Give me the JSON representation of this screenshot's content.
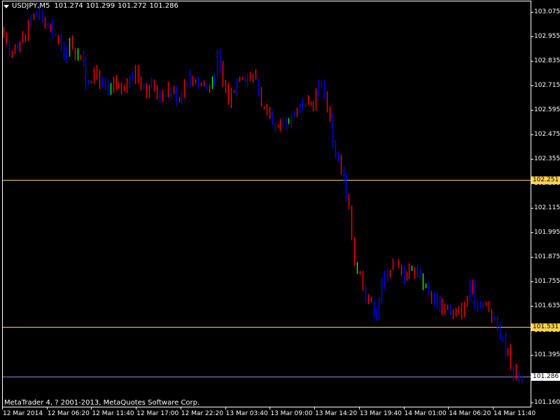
{
  "header": {
    "symbol": "USDJPY,M5",
    "quote_values": [
      "101.274",
      "101.299",
      "101.272",
      "101.286"
    ]
  },
  "footer": {
    "copyright": "MetaTrader 4, ? 2001-2013, MetaQuotes Software Corp."
  },
  "colors": {
    "background": "#000000",
    "frame": "#ffffff",
    "candle_bull": "#00ff00",
    "candle_bear": "#ff0000",
    "candle_mixed": "#0000ff",
    "hline": "#ffcc66",
    "hline_label_bg": "#ffd24d",
    "bid_line": "#8a8ac8",
    "bid_label_bg": "#ffffff"
  },
  "chart_data": {
    "type": "candlestick",
    "title": "USDJPY,M5",
    "ylim": [
      101.14,
      103.13
    ],
    "yticks": [
      "103.075",
      "102.955",
      "102.835",
      "102.715",
      "102.595",
      "102.475",
      "102.355",
      "102.235",
      "102.115",
      "101.995",
      "101.875",
      "101.755",
      "101.635",
      "101.515",
      "101.395",
      "101.160"
    ],
    "xticks": [
      "12 Mar 2014",
      "12 Mar 06:20",
      "12 Mar 11:40",
      "12 Mar 17:00",
      "12 Mar 22:20",
      "13 Mar 03:40",
      "13 Mar 09:00",
      "13 Mar 14:20",
      "13 Mar 19:40",
      "14 Mar 01:00",
      "14 Mar 06:20",
      "14 Mar 11:40"
    ],
    "horizontal_lines": [
      {
        "value": 102.251,
        "label": "102.251"
      },
      {
        "value": 101.531,
        "label": "101.531"
      }
    ],
    "bid_line": {
      "value": 101.286,
      "label": "101.286"
    },
    "price_path": [
      [
        0,
        102.95
      ],
      [
        2,
        102.86
      ],
      [
        4,
        102.91
      ],
      [
        6,
        102.93
      ],
      [
        8,
        102.97
      ],
      [
        10,
        103.05
      ],
      [
        12,
        103.07
      ],
      [
        14,
        103.03
      ],
      [
        16,
        102.99
      ],
      [
        18,
        102.98
      ],
      [
        20,
        102.93
      ],
      [
        22,
        102.86
      ],
      [
        24,
        102.93
      ],
      [
        26,
        102.88
      ],
      [
        28,
        102.87
      ],
      [
        30,
        102.73
      ],
      [
        32,
        102.76
      ],
      [
        34,
        102.76
      ],
      [
        36,
        102.72
      ],
      [
        38,
        102.67
      ],
      [
        40,
        102.72
      ],
      [
        42,
        102.68
      ],
      [
        44,
        102.71
      ],
      [
        46,
        102.73
      ],
      [
        48,
        102.8
      ],
      [
        50,
        102.73
      ],
      [
        52,
        102.69
      ],
      [
        54,
        102.71
      ],
      [
        56,
        102.68
      ],
      [
        58,
        102.67
      ],
      [
        60,
        102.7
      ],
      [
        62,
        102.68
      ],
      [
        64,
        102.66
      ],
      [
        66,
        102.73
      ],
      [
        68,
        102.75
      ],
      [
        70,
        102.74
      ],
      [
        72,
        102.73
      ],
      [
        74,
        102.71
      ],
      [
        76,
        102.73
      ],
      [
        78,
        102.84
      ],
      [
        80,
        102.74
      ],
      [
        82,
        102.65
      ],
      [
        84,
        102.7
      ],
      [
        86,
        102.77
      ],
      [
        88,
        102.76
      ],
      [
        90,
        102.76
      ],
      [
        92,
        102.75
      ],
      [
        94,
        102.63
      ],
      [
        96,
        102.57
      ],
      [
        98,
        102.51
      ],
      [
        100,
        102.5
      ],
      [
        102,
        102.52
      ],
      [
        104,
        102.56
      ],
      [
        106,
        102.58
      ],
      [
        108,
        102.61
      ],
      [
        110,
        102.6
      ],
      [
        112,
        102.62
      ],
      [
        114,
        102.67
      ],
      [
        116,
        102.74
      ],
      [
        118,
        102.62
      ],
      [
        120,
        102.45
      ],
      [
        122,
        102.34
      ],
      [
        124,
        102.25
      ],
      [
        126,
        102.1
      ],
      [
        128,
        101.85
      ],
      [
        130,
        101.78
      ],
      [
        132,
        101.7
      ],
      [
        134,
        101.64
      ],
      [
        136,
        101.6
      ],
      [
        138,
        101.73
      ],
      [
        140,
        101.82
      ],
      [
        142,
        101.83
      ],
      [
        144,
        101.82
      ],
      [
        146,
        101.78
      ],
      [
        148,
        101.82
      ],
      [
        150,
        101.8
      ],
      [
        152,
        101.8
      ],
      [
        154,
        101.72
      ],
      [
        156,
        101.68
      ],
      [
        158,
        101.65
      ],
      [
        160,
        101.64
      ],
      [
        162,
        101.63
      ],
      [
        164,
        101.59
      ],
      [
        166,
        101.61
      ],
      [
        168,
        101.63
      ],
      [
        170,
        101.74
      ],
      [
        172,
        101.66
      ],
      [
        174,
        101.65
      ],
      [
        176,
        101.63
      ],
      [
        178,
        101.58
      ],
      [
        180,
        101.53
      ],
      [
        182,
        101.46
      ],
      [
        184,
        101.4
      ],
      [
        186,
        101.3
      ],
      [
        188,
        101.29
      ]
    ]
  }
}
